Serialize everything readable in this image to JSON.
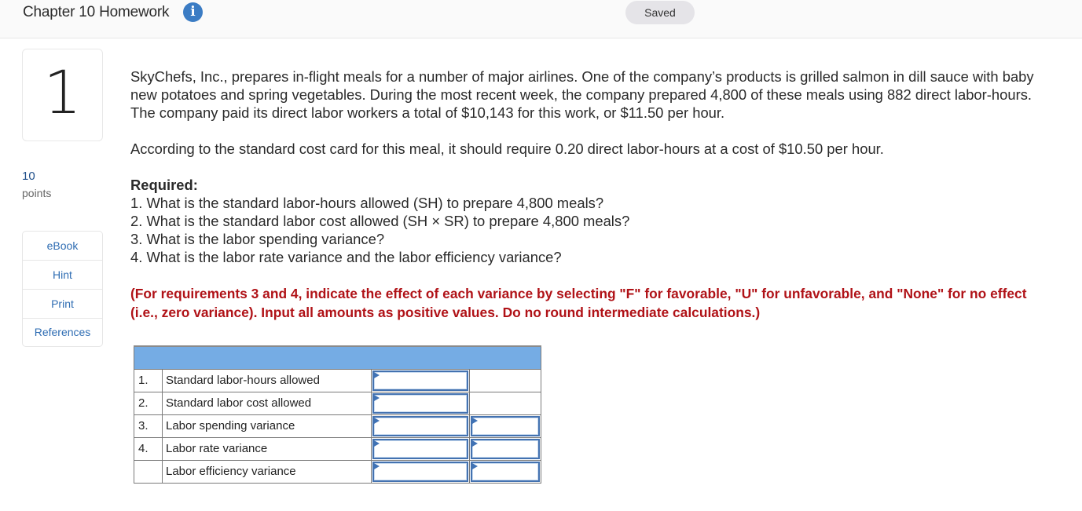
{
  "header": {
    "title": "Chapter 10 Homework",
    "info_icon": "info-icon",
    "saved_label": "Saved"
  },
  "question": {
    "number": "1",
    "points_value": "10",
    "points_label": "points"
  },
  "sidebar": {
    "items": [
      {
        "label": "eBook"
      },
      {
        "label": "Hint"
      },
      {
        "label": "Print"
      },
      {
        "label": "References"
      }
    ]
  },
  "content": {
    "paragraph1": "SkyChefs, Inc., prepares in-flight meals for a number of major airlines. One of the company’s products is grilled salmon in dill sauce with baby new potatoes and spring vegetables. During the most recent week, the company prepared 4,800 of these meals using 882 direct labor-hours. The company paid its direct labor workers a total of $10,143 for this work, or $11.50 per hour.",
    "paragraph2": "According to the standard cost card for this meal, it should require 0.20 direct labor-hours at a cost of $10.50 per hour.",
    "required_heading": "Required:",
    "requirements": [
      "1. What is the standard labor-hours allowed (SH) to prepare 4,800 meals?",
      "2. What is the standard labor cost allowed (SH × SR) to prepare 4,800 meals?",
      "3. What is the labor spending variance?",
      "4. What is the labor rate variance and the labor efficiency variance?"
    ],
    "instructions": "(For requirements 3 and 4, indicate the effect of each variance by selecting \"F\" for favorable, \"U\" for unfavorable, and \"None\" for no effect (i.e., zero variance). Input all amounts as positive values. Do no round intermediate calculations.)"
  },
  "answer_table": {
    "rows": [
      {
        "num": "1.",
        "label": "Standard labor-hours allowed",
        "amount": "",
        "has_effect": false,
        "effect": ""
      },
      {
        "num": "2.",
        "label": "Standard labor cost allowed",
        "amount": "",
        "has_effect": false,
        "effect": ""
      },
      {
        "num": "3.",
        "label": "Labor spending variance",
        "amount": "",
        "has_effect": true,
        "effect": ""
      },
      {
        "num": "4.",
        "label": "Labor rate variance",
        "amount": "",
        "has_effect": true,
        "effect": ""
      },
      {
        "num": "",
        "label": "Labor efficiency variance",
        "amount": "",
        "has_effect": true,
        "effect": ""
      }
    ]
  },
  "colors": {
    "accent_blue": "#3b7cc4",
    "table_header": "#75ace4",
    "instruction_red": "#b01217",
    "link_blue": "#2f6db3"
  }
}
